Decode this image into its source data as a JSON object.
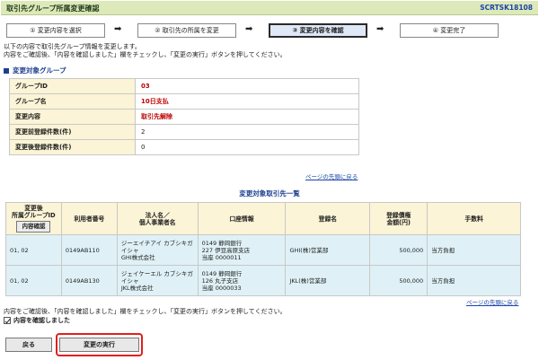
{
  "header": {
    "title": "取引先グループ所属変更確認",
    "code": "SCRTSK18108"
  },
  "steps": [
    {
      "label": "① 変更内容を選択"
    },
    {
      "label": "② 取引先の所属を変更"
    },
    {
      "label": "③ 変更内容を確認"
    },
    {
      "label": "④ 変更完了"
    }
  ],
  "active_step": 2,
  "step_arrow": "➡",
  "intro": {
    "line1": "以下の内容で取引先グループ情報を変更します。",
    "line2": "内容をご確認後、「内容を確認しました」欄をチェックし、「変更の実行」ボタンを押してください。"
  },
  "target_group": {
    "section_title": "変更対象グループ",
    "rows": [
      {
        "label": "グループID",
        "value": "03"
      },
      {
        "label": "グループ名",
        "value": "10日支払"
      },
      {
        "label": "変更内容",
        "value": "取引先解除"
      },
      {
        "label": "変更前登録件数(件)",
        "value": "2"
      },
      {
        "label": "変更後登録件数(件)",
        "value": "0"
      }
    ]
  },
  "links": {
    "page_top": "ページの先頭に戻る"
  },
  "list": {
    "title": "変更対象取引先一覧",
    "headers": {
      "group_line1": "変更後",
      "group_line2": "所属グループID",
      "detail_button": "内容確認",
      "user_no": "利用者番号",
      "name_line1": "法人名／",
      "name_line2": "個人事業者名",
      "account": "口座情報",
      "reg_name": "登録名",
      "limit_line1": "登録債権",
      "limit_line2": "金額(円)",
      "fee": "手数料"
    },
    "rows": [
      {
        "group": "01, 02",
        "user_no": "0149AB110",
        "name_kana": "ジーエイチアイ カブシキガイシャ",
        "name": "GHI株式会社",
        "bank": "0149 静岡銀行",
        "branch": "227 伊豆高原支店",
        "account": "当座 0000011",
        "reg_name": "GHI(株)営業部",
        "amount": "500,000",
        "fee": "当方負担"
      },
      {
        "group": "01, 02",
        "user_no": "0149AB130",
        "name_kana": "ジェイケーエル カブシキガイシャ",
        "name": "JKL株式会社",
        "bank": "0149 静岡銀行",
        "branch": "126 丸子支店",
        "account": "当座 0000033",
        "reg_name": "JKL(株)営業部",
        "amount": "500,000",
        "fee": "当方負担"
      }
    ]
  },
  "confirm": {
    "text": "内容をご確認後、「内容を確認しました」欄をチェックし、「変更の実行」ボタンを押してください。",
    "checkbox_label": "内容を確認しました",
    "checked": true
  },
  "buttons": {
    "back": "戻る",
    "execute": "変更の実行"
  },
  "colors": {
    "title_bg": "#dde9b8",
    "label_bg": "#fbf4d6",
    "row_bg": "#dff1f6",
    "highlight": "#e0201c",
    "link": "#1a44a8"
  }
}
